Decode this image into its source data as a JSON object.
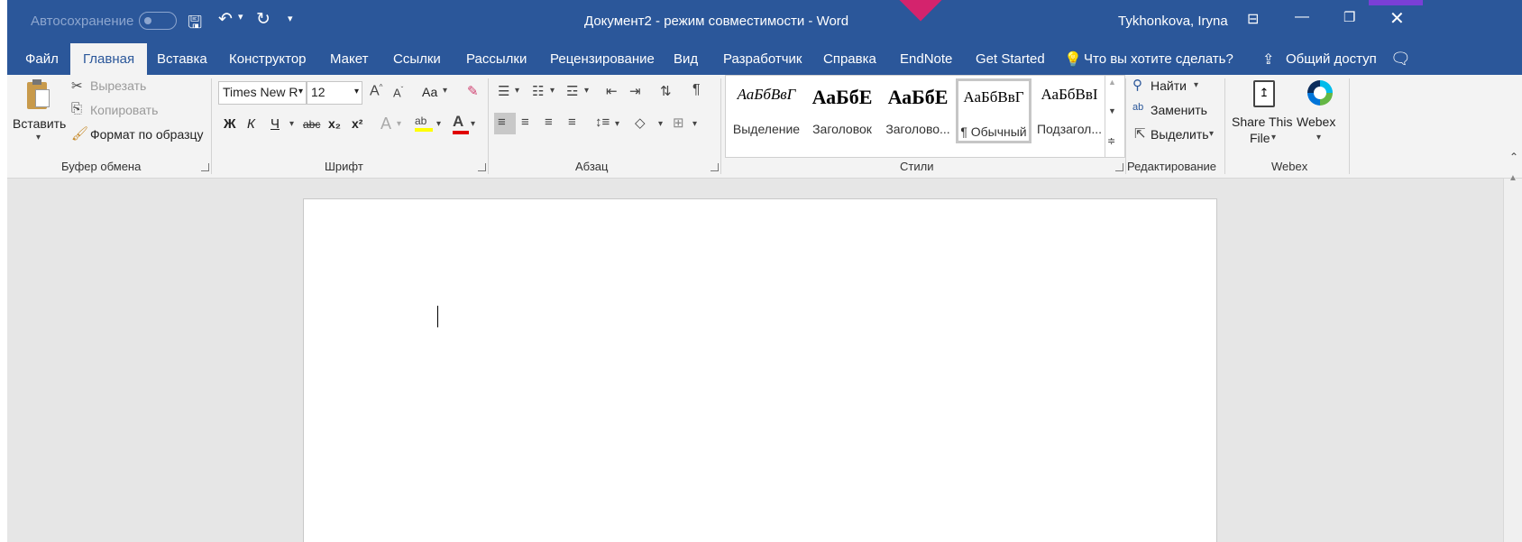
{
  "titlebar": {
    "autosave_label": "Автосохранение",
    "title": "Документ2  -  режим совместимости  -  Word",
    "user": "Tykhonkova, Iryna"
  },
  "tabs": [
    "Файл",
    "Главная",
    "Вставка",
    "Конструктор",
    "Макет",
    "Ссылки",
    "Рассылки",
    "Рецензирование",
    "Вид",
    "Разработчик",
    "Справка",
    "EndNote",
    "Get Started"
  ],
  "tell_me": "Что вы хотите сделать?",
  "share": "Общий доступ",
  "clipboard": {
    "paste": "Вставить",
    "cut": "Вырезать",
    "copy": "Копировать",
    "format_painter": "Формат по образцу",
    "label": "Буфер обмена"
  },
  "font": {
    "name": "Times New R",
    "size": "12",
    "case_btn": "Аа",
    "bold": "Ж",
    "italic": "К",
    "underline": "Ч",
    "strike": "abc",
    "sub": "x₂",
    "sup": "x²",
    "label": "Шрифт"
  },
  "paragraph": {
    "label": "Абзац"
  },
  "styles": {
    "items": [
      {
        "preview": "АаБбВвГ",
        "name": "Выделение",
        "italic": true,
        "bold": false,
        "size": 17
      },
      {
        "preview": "АаБбЕ",
        "name": "Заголовок",
        "italic": false,
        "bold": true,
        "size": 22
      },
      {
        "preview": "АаБбЕ",
        "name": "Заголово...",
        "italic": false,
        "bold": true,
        "size": 22
      },
      {
        "preview": "АаБбВвГ",
        "name": "¶ Обычный",
        "italic": false,
        "bold": false,
        "size": 17
      },
      {
        "preview": "АаБбВвІ",
        "name": "Подзагол...",
        "italic": false,
        "bold": false,
        "size": 17
      }
    ],
    "label": "Стили"
  },
  "editing": {
    "find": "Найти",
    "replace": "Заменить",
    "select": "Выделить",
    "label": "Редактирование"
  },
  "webex": {
    "share_line1": "Share This",
    "share_line2": "File",
    "webex_btn": "Webex",
    "label": "Webex"
  },
  "colors": {
    "accent": "#2b579a",
    "highlight": "#ffff00",
    "font_color": "#e00000",
    "pink_badge": "#d4236d"
  }
}
